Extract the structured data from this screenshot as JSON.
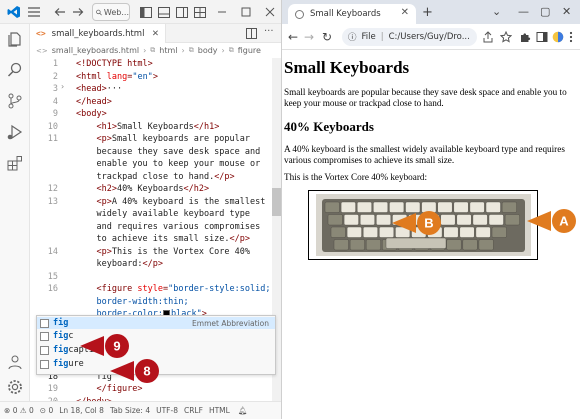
{
  "vscode": {
    "search_label": "Web...",
    "tab_label": "small_keyboards.html",
    "tab_lang_icon": "html-file-icon",
    "breadcrumb": [
      "small_keyboards.html",
      "html",
      "body",
      "figure"
    ],
    "lines": [
      {
        "num": "1",
        "html": "&lt;!DOCTYPE html&gt;"
      },
      {
        "num": "2",
        "html": "&lt;html <span class='a'>lang</span>=<span class='v'>\"en\"</span>&gt;"
      },
      {
        "num": "3",
        "html": "&lt;head&gt;<span class='x'>···</span>"
      },
      {
        "num": "4",
        "html": "&lt;/head&gt;"
      },
      {
        "num": "9",
        "html": "&lt;body&gt;"
      },
      {
        "num": "10",
        "html": "    &lt;h1&gt;<span class='x'>Small Keyboards</span>&lt;/h1&gt;"
      },
      {
        "num": "11",
        "html": "    &lt;p&gt;<span class='x'>Small keyboards are popular</span>"
      },
      {
        "num": "",
        "html": "    <span class='x'>because they save desk space and</span>"
      },
      {
        "num": "",
        "html": "    <span class='x'>enable you to keep your mouse or</span>"
      },
      {
        "num": "",
        "html": "    <span class='x'>trackpad close to hand.</span>&lt;/p&gt;"
      },
      {
        "num": "12",
        "html": "    &lt;h2&gt;<span class='x'>40% Keyboards</span>&lt;/h2&gt;"
      },
      {
        "num": "13",
        "html": "    &lt;p&gt;<span class='x'>A 40% keyboard is the smallest</span>"
      },
      {
        "num": "",
        "html": "    <span class='x'>widely available keyboard type</span>"
      },
      {
        "num": "",
        "html": "    <span class='x'>and requires various compromises</span>"
      },
      {
        "num": "",
        "html": "    <span class='x'>to achieve its small size.</span>&lt;/p&gt;"
      },
      {
        "num": "14",
        "html": "    &lt;p&gt;<span class='x'>This is the Vortex Core 40%</span>"
      },
      {
        "num": "",
        "html": "    <span class='x'>keyboard:</span>&lt;/p&gt;"
      },
      {
        "num": "15",
        "html": ""
      },
      {
        "num": "16",
        "html": "    &lt;figure <span class='a'>style</span>=<span class='v'>\"border-style:solid;</span>"
      },
      {
        "num": "",
        "html": "    <span class='v'>border-width:thin;</span>"
      },
      {
        "num": "",
        "html": "    <span class='v'>border-color:<span class='swatch'></span>black\"</span>&gt;"
      },
      {
        "num": "17",
        "html": ""
      },
      {
        "num": "",
        "html": ""
      },
      {
        "num": "",
        "html": ""
      },
      {
        "num": "",
        "html": ""
      },
      {
        "num": "18",
        "html": "    <span class='x'>fig</span>"
      },
      {
        "num": "19",
        "html": "    &lt;/figure&gt;"
      },
      {
        "num": "20",
        "html": "&lt;/body&gt;"
      }
    ],
    "suggestions": [
      {
        "match": "fig",
        "rest": "",
        "detail": "Emmet Abbreviation"
      },
      {
        "match": "fig",
        "rest": "c",
        "detail": ""
      },
      {
        "match": "fig",
        "rest": "caption",
        "detail": ""
      },
      {
        "match": "fig",
        "rest": "ure",
        "detail": ""
      }
    ],
    "status": {
      "errors": "0",
      "warnings": "0",
      "ports": "0",
      "position": "Ln 18, Col 8",
      "tab_size": "Tab Size: 4",
      "encoding": "UTF-8",
      "eol": "CRLF",
      "language": "HTML"
    }
  },
  "browser": {
    "tab_title": "Small Keyboards",
    "address_scheme": "File",
    "address_path": "C:/Users/Guy/Dro...",
    "page": {
      "h1": "Small Keyboards",
      "p1": "Small keyboards are popular because they save desk space and enable you to keep your mouse or trackpad close to hand.",
      "h2": "40% Keyboards",
      "p2": "A 40% keyboard is the smallest widely available keyboard type and requires various compromises to achieve its small size.",
      "p3": "This is the Vortex Core 40% keyboard:"
    }
  },
  "callouts": {
    "a": "A",
    "b": "B",
    "n8": "8",
    "n9": "9",
    "color": "#e07b1f",
    "number_color": "#b5121b"
  }
}
